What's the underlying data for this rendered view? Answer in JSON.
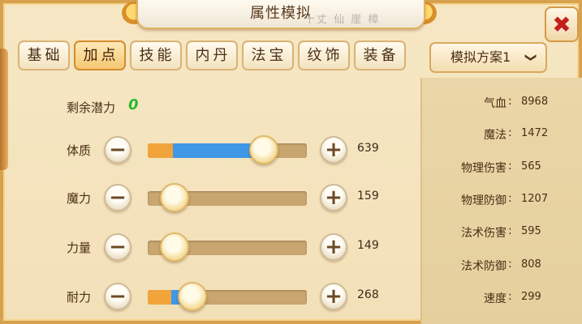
{
  "title": "属性模拟",
  "title_ink": "十丈 仙 崖 樟",
  "close_glyph": "✖",
  "tabs": [
    "基础",
    "加点",
    "技能",
    "内丹",
    "法宝",
    "纹饰",
    "装备"
  ],
  "active_tab": 1,
  "plan_select": {
    "value": "模拟方案1",
    "chevron": "❯"
  },
  "potential": {
    "label": "剩余潜力",
    "value": "0"
  },
  "attributes": [
    {
      "label": "体质",
      "value": "639",
      "orange": 0.16,
      "blue": 0.57,
      "knob": 0.73
    },
    {
      "label": "魔力",
      "value": "159",
      "orange": 0.0,
      "blue": 0.0,
      "knob": 0.17
    },
    {
      "label": "力量",
      "value": "149",
      "orange": 0.0,
      "blue": 0.0,
      "knob": 0.17
    },
    {
      "label": "耐力",
      "value": "268",
      "orange": 0.15,
      "blue": 0.12,
      "knob": 0.28
    }
  ],
  "buttons": {
    "minus": "−",
    "plus": "+"
  },
  "stats": [
    {
      "name": "气血",
      "value": "8968"
    },
    {
      "name": "魔法",
      "value": "1472"
    },
    {
      "name": "物理伤害",
      "value": "565"
    },
    {
      "name": "物理防御",
      "value": "1207"
    },
    {
      "name": "法术伤害",
      "value": "595"
    },
    {
      "name": "法术防御",
      "value": "808"
    },
    {
      "name": "速度",
      "value": "299"
    }
  ],
  "colors": {
    "accent": "#f0a43a",
    "bar_blue": "#3f98e6",
    "potential_green": "#2fb52a",
    "close_red": "#c4201a"
  }
}
